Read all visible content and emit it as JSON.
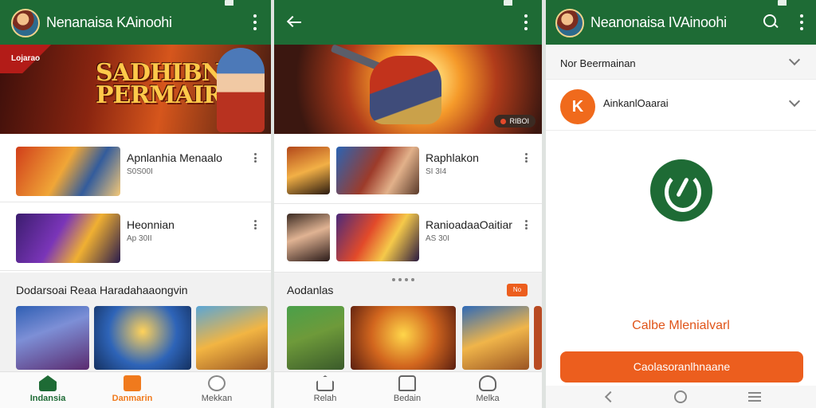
{
  "screen1": {
    "title": "Nenanaisa KAinoohi",
    "banner": {
      "tag": "Lojarao",
      "headline_1": "SADHIBN",
      "headline_2": "PERMAIRAN"
    },
    "list": [
      {
        "name": "Apnlanhia Menaalo",
        "meta": "S0S00I"
      },
      {
        "name": "Heonnian",
        "meta": "Ap 30II"
      }
    ],
    "section_title": "Dodarsoai Reaa Haradahaaongvin",
    "nav": [
      {
        "label": "Indansia",
        "icon": "home-icon"
      },
      {
        "label": "Danmarin",
        "icon": "store-icon"
      },
      {
        "label": "Mekkan",
        "icon": "ranking-icon"
      }
    ]
  },
  "screen2": {
    "banner": {
      "pill": "RIBOI"
    },
    "list": [
      {
        "name": "Raphlakon",
        "meta": "SI 3I4"
      },
      {
        "name": "RanioadaaOaitiar",
        "meta": "AS 30I"
      }
    ],
    "section_title": "Aodanlas",
    "tag": "No",
    "nav": [
      {
        "label": "Relah",
        "icon": "home-outline-icon"
      },
      {
        "label": "Bedain",
        "icon": "bag-outline-icon"
      },
      {
        "label": "Melka",
        "icon": "user-outline-icon"
      }
    ]
  },
  "screen3": {
    "title": "Neanonaisa IVAinoohi",
    "row1": "Nor Beermainan",
    "row2": "AinkanlOaarai",
    "cta_text": "Calbe Mlenialvarl",
    "cta_button": "Caolasoranlhnaane"
  },
  "colors": {
    "appbar": "#1e6b35",
    "accent": "#ec5e1e"
  }
}
